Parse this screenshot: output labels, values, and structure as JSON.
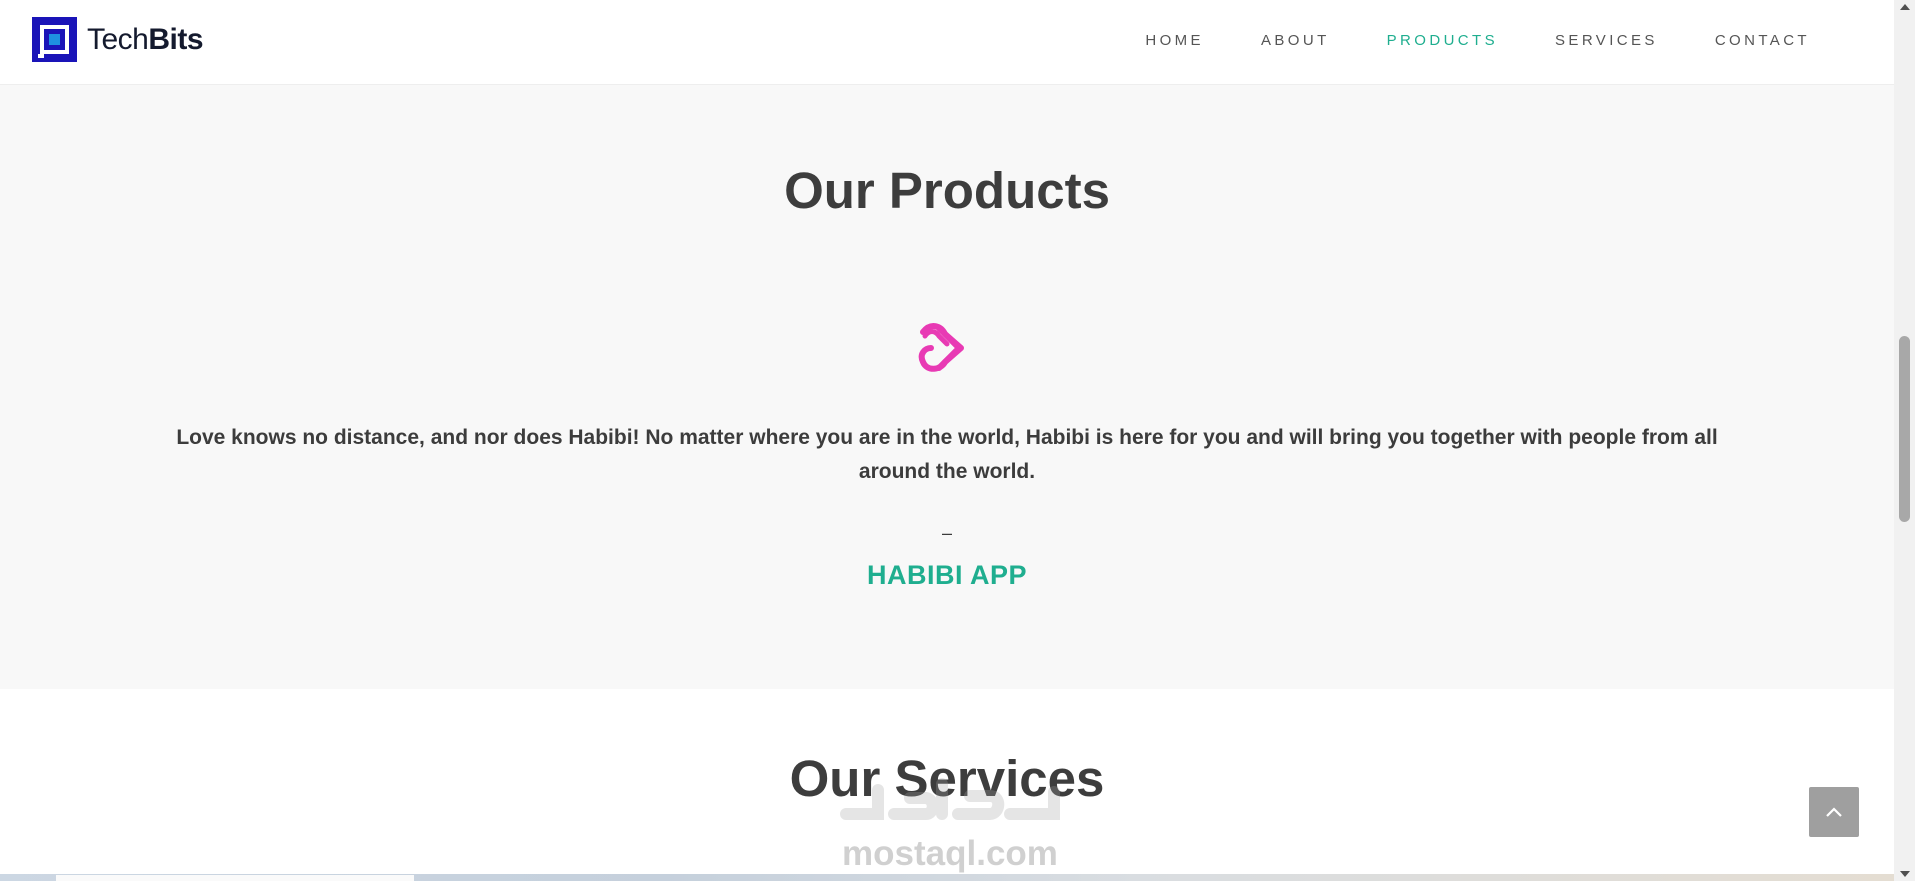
{
  "brand": {
    "name_light": "Tech",
    "name_bold": "Bits"
  },
  "nav": {
    "items": [
      {
        "label": "HOME"
      },
      {
        "label": "ABOUT"
      },
      {
        "label": "PRODUCTS",
        "active": true
      },
      {
        "label": "SERVICES"
      },
      {
        "label": "CONTACT"
      }
    ]
  },
  "products": {
    "title": "Our Products",
    "logo_icon": "habibi-heart-logo-icon",
    "description": "Love knows no distance, and nor does Habibi! No matter where you are in the world, Habibi is here for you and will bring you together with people from all around the world.",
    "dash": "–",
    "product_name": "HABIBI APP"
  },
  "services": {
    "title": "Our Services"
  },
  "watermark": {
    "text": "mostaql.com"
  },
  "colors": {
    "accent": "#1fae8f",
    "logo_blue": "#1a14b8",
    "logo_light_blue": "#1e90e0",
    "habibi_pink": "#e83ab4",
    "section_bg": "#f8f8f8",
    "back_to_top_bg": "#9f9f9f"
  }
}
